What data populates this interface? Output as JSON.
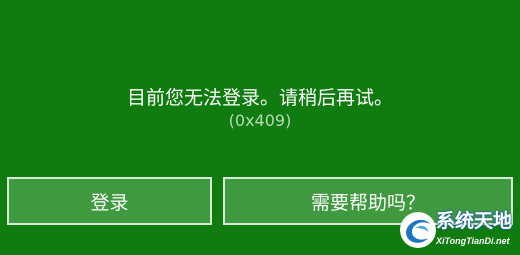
{
  "screen": {
    "message": "目前您无法登录。请稍后再试。",
    "error_code": "(0x409)"
  },
  "buttons": {
    "sign_in_label": "登录",
    "help_label": "需要帮助吗？"
  },
  "watermark": {
    "title": "系统天地",
    "url": "XiTongTianDi.net"
  },
  "colors": {
    "background": "#107c10",
    "button_fill": "#3f9a3f",
    "button_border": "#d6e9d6",
    "error_code_text": "#b9d9b9"
  },
  "icons": {
    "watermark_logo": "swirl-logo-icon"
  }
}
